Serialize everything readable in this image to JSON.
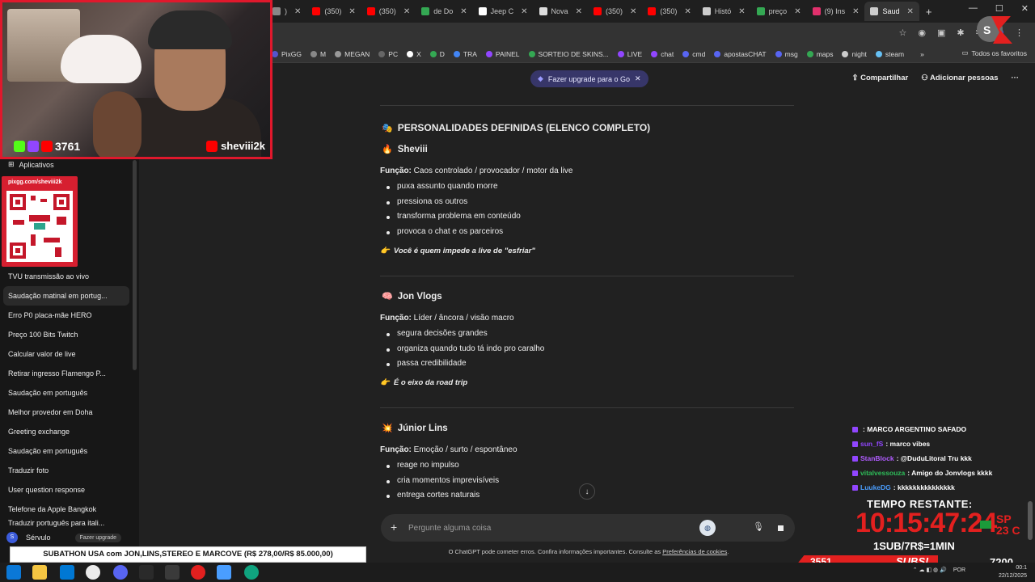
{
  "browser": {
    "tabs": [
      {
        "label": ")",
        "color": "#888"
      },
      {
        "label": "(350)",
        "color": "#ff0000"
      },
      {
        "label": "(350)",
        "color": "#ff0000"
      },
      {
        "label": "de Do",
        "color": "#34a853"
      },
      {
        "label": "Jeep C",
        "color": "#ffffff"
      },
      {
        "label": "Nova",
        "color": "#dddddd"
      },
      {
        "label": "(350)",
        "color": "#ff0000"
      },
      {
        "label": "(350)",
        "color": "#ff0000"
      },
      {
        "label": "Histó",
        "color": "#cccccc"
      },
      {
        "label": "preço",
        "color": "#34a853"
      },
      {
        "label": "(9) Ins",
        "color": "#e1306c"
      },
      {
        "label": "Saud",
        "color": "#cccccc"
      }
    ],
    "new_tab": "+",
    "bookmarks": [
      {
        "label": "PixGG",
        "color": "#55c"
      },
      {
        "label": "M",
        "color": "#888"
      },
      {
        "label": "MEGAN",
        "color": "#999"
      },
      {
        "label": "PC",
        "color": "#666"
      },
      {
        "label": "X",
        "color": "#fff"
      },
      {
        "label": "D",
        "color": "#34a853"
      },
      {
        "label": "TRA",
        "color": "#4285f4"
      },
      {
        "label": "PAINEL",
        "color": "#9146ff"
      },
      {
        "label": "SORTEIO DE SKINS...",
        "color": "#34a853"
      },
      {
        "label": "LIVE",
        "color": "#9146ff"
      },
      {
        "label": "chat",
        "color": "#9146ff"
      },
      {
        "label": "cmd",
        "color": "#5865f2"
      },
      {
        "label": "apostasCHAT",
        "color": "#5865f2"
      },
      {
        "label": "msg",
        "color": "#5865f2"
      },
      {
        "label": "maps",
        "color": "#34a853"
      },
      {
        "label": "night",
        "color": "#ccc"
      },
      {
        "label": "steam",
        "color": "#66c0f4"
      }
    ],
    "bookmarks_more": "»",
    "all_favorites": "Todos os favoritos"
  },
  "sidebar": {
    "apps_label": "Aplicativos",
    "chats": [
      "TVU transmissão ao vivo",
      "Saudação matinal em portug...",
      "Erro P0 placa-mãe HERO",
      "Preço 100 Bits Twitch",
      "Calcular valor de live",
      "Retirar ingresso Flamengo P...",
      "Saudação em português",
      "Melhor provedor em Doha",
      "Greeting exchange",
      "Saudação em português",
      "Traduzir foto",
      "User question response",
      "Telefone da Apple Bangkok",
      "Traduzir português para itali..."
    ],
    "user_initial": "S",
    "user_name": "Sérvulo",
    "upgrade": "Fazer upgrade"
  },
  "header": {
    "upgrade_pill": "Fazer upgrade para o Go",
    "share": "Compartilhar",
    "add_people": "Adicionar pessoas",
    "more": "···"
  },
  "content": {
    "section_title": "PERSONALIDADES DEFINIDAS (ELENCO COMPLETO)",
    "func_label": "Função:",
    "people": [
      {
        "name": "Sheviii",
        "emoji": "🔥",
        "funcao": "Caos controlado / provocador / motor da live",
        "bullets": [
          "puxa assunto quando morre",
          "pressiona os outros",
          "transforma problema em conteúdo",
          "provoca o chat e os parceiros"
        ],
        "note": "Você é quem impede a live de \"esfriar\""
      },
      {
        "name": "Jon Vlogs",
        "emoji": "🧠",
        "funcao": "Líder / âncora / visão macro",
        "bullets": [
          "segura decisões grandes",
          "organiza quando tudo tá indo pro caralho",
          "passa credibilidade"
        ],
        "note": "É o eixo da road trip"
      },
      {
        "name": "Júnior Lins",
        "emoji": "💥",
        "funcao": "Emoção / surto / espontâneo",
        "bullets": [
          "reage no impulso",
          "cria momentos imprevisíveis",
          "entrega cortes naturais"
        ],
        "note": ""
      }
    ]
  },
  "composer": {
    "placeholder": "Pergunte alguma coisa",
    "disclaimer": "O ChatGPT pode cometer erros. Confira informações importantes. Consulte as",
    "disclaimer_link": "Preferências de cookies"
  },
  "stream": {
    "viewer_count": "3761",
    "channel": "sheviii2k",
    "pix_url": "pixgg.com/sheviii2k",
    "subathon_banner": "SUBATHON USA com JON,LINS,STEREO E MARCOVE (R$ 278,00/R$ 85.000,00)",
    "chat": [
      {
        "user": "",
        "user_color": "#4a78ff",
        "msg": ": MARCO ARGENTINO SAFADO"
      },
      {
        "user": "sun_fS",
        "user_color": "#9146ff",
        "msg": ": marco vibes"
      },
      {
        "user": "StanBlock",
        "user_color": "#b05cff",
        "msg": ": @DuduLitoral Tru kkk"
      },
      {
        "user": "vitalvessouza",
        "user_color": "#2ebd59",
        "msg": ": Amigo do Jonvlogs kkkk"
      },
      {
        "user": "LuukeDG",
        "user_color": "#4a9eff",
        "msg": ": kkkkkkkkkkkkkkk"
      }
    ],
    "timer_label": "TEMPO RESTANTE:",
    "timer_value": "10:15:47:24",
    "city": "SP",
    "temperature": "23 C",
    "rate": "1SUB/7R$=1MIN",
    "subs_count": "3551",
    "subs_label": "SUBS!",
    "subs_goal": "7200"
  },
  "taskbar": {
    "lang": "POR",
    "time": "00:1",
    "date": "22/12/2025"
  }
}
